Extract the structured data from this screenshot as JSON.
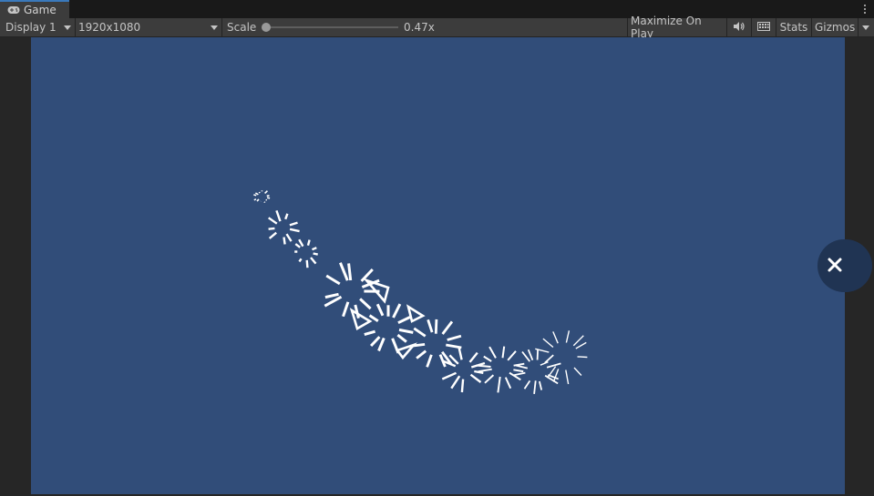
{
  "window": {
    "tab_label": "Game",
    "tab_icon": "gamepad-icon"
  },
  "toolbar": {
    "display": "Display 1",
    "resolution": "1920x1080",
    "scale_label": "Scale",
    "scale_value": "0.47x",
    "scale_slider_fraction": 0.0,
    "maximize_on_play": "Maximize On Play",
    "mute_icon": "speaker-icon",
    "stats_icon": "keyboard-icon",
    "stats": "Stats",
    "gizmos": "Gizmos"
  },
  "game": {
    "background": "#314d79",
    "particle_color": "#ffffff",
    "close_icon": "close-icon",
    "close_button_color": "#203453"
  }
}
